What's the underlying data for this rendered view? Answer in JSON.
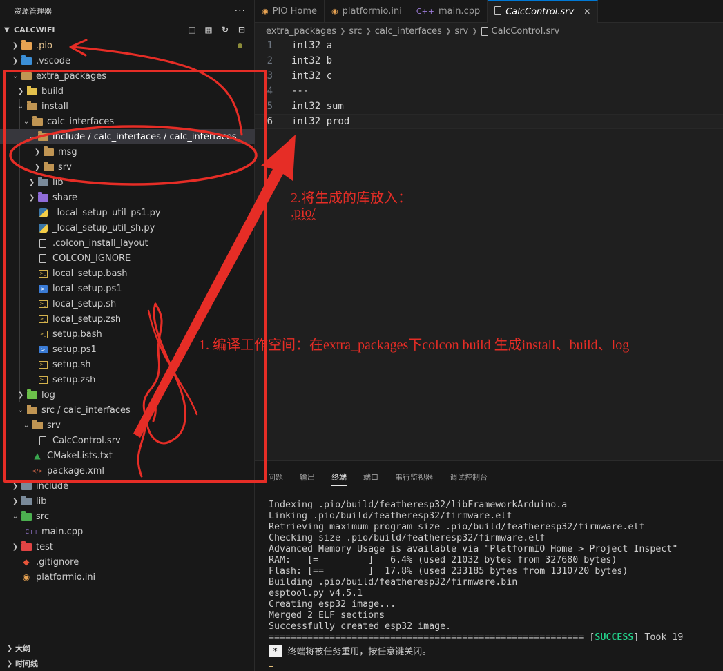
{
  "sidebar": {
    "title": "资源管理器",
    "more": "···",
    "workspace": "CALCWIFI",
    "tree": [
      {
        "label": ".pio",
        "depth": 1,
        "chev": "closed",
        "icon": "pio-folder-icon",
        "color": "#e8a352"
      },
      {
        "label": ".vscode",
        "depth": 1,
        "chev": "closed",
        "icon": "vscode-folder-icon",
        "color": "#3b8fd8"
      },
      {
        "label": "extra_packages",
        "depth": 1,
        "chev": "open",
        "icon": "folder-icon",
        "color": "#c09553"
      },
      {
        "label": "build",
        "depth": 2,
        "chev": "closed",
        "icon": "build-folder-icon",
        "color": "#e3c04c"
      },
      {
        "label": "install",
        "depth": 2,
        "chev": "open",
        "icon": "folder-icon",
        "color": "#c09553"
      },
      {
        "label": "calc_interfaces",
        "depth": 3,
        "chev": "open",
        "icon": "folder-icon",
        "color": "#c09553"
      },
      {
        "label": "include / calc_interfaces / calc_interfaces",
        "depth": 4,
        "chev": "open",
        "icon": "folder-icon",
        "color": "#c09553",
        "selected": true
      },
      {
        "label": "msg",
        "depth": 5,
        "chev": "closed",
        "icon": "folder-icon",
        "color": "#c09553"
      },
      {
        "label": "srv",
        "depth": 5,
        "chev": "closed",
        "icon": "folder-icon",
        "color": "#c09553"
      },
      {
        "label": "lib",
        "depth": 4,
        "chev": "closed",
        "icon": "lib-folder-icon",
        "color": "#7a8a9a"
      },
      {
        "label": "share",
        "depth": 4,
        "chev": "closed",
        "icon": "share-folder-icon",
        "color": "#8f6cd8"
      },
      {
        "label": "_local_setup_util_ps1.py",
        "depth": 4,
        "chev": "none",
        "icon": "python-file-icon"
      },
      {
        "label": "_local_setup_util_sh.py",
        "depth": 4,
        "chev": "none",
        "icon": "python-file-icon"
      },
      {
        "label": ".colcon_install_layout",
        "depth": 4,
        "chev": "none",
        "icon": "file-icon"
      },
      {
        "label": "COLCON_IGNORE",
        "depth": 4,
        "chev": "none",
        "icon": "file-icon"
      },
      {
        "label": "local_setup.bash",
        "depth": 4,
        "chev": "none",
        "icon": "shell-file-icon"
      },
      {
        "label": "local_setup.ps1",
        "depth": 4,
        "chev": "none",
        "icon": "powershell-file-icon"
      },
      {
        "label": "local_setup.sh",
        "depth": 4,
        "chev": "none",
        "icon": "shell-file-icon"
      },
      {
        "label": "local_setup.zsh",
        "depth": 4,
        "chev": "none",
        "icon": "shell-file-icon"
      },
      {
        "label": "setup.bash",
        "depth": 4,
        "chev": "none",
        "icon": "shell-file-icon"
      },
      {
        "label": "setup.ps1",
        "depth": 4,
        "chev": "none",
        "icon": "powershell-file-icon"
      },
      {
        "label": "setup.sh",
        "depth": 4,
        "chev": "none",
        "icon": "shell-file-icon"
      },
      {
        "label": "setup.zsh",
        "depth": 4,
        "chev": "none",
        "icon": "shell-file-icon"
      },
      {
        "label": "log",
        "depth": 2,
        "chev": "closed",
        "icon": "log-folder-icon",
        "color": "#6cc04a"
      },
      {
        "label": "src / calc_interfaces",
        "depth": 2,
        "chev": "open",
        "icon": "folder-icon",
        "color": "#c09553"
      },
      {
        "label": "srv",
        "depth": 3,
        "chev": "open",
        "icon": "folder-icon",
        "color": "#c09553"
      },
      {
        "label": "CalcControl.srv",
        "depth": 4,
        "chev": "none",
        "icon": "file-icon"
      },
      {
        "label": "CMakeLists.txt",
        "depth": 3,
        "chev": "none",
        "icon": "cmake-file-icon"
      },
      {
        "label": "package.xml",
        "depth": 3,
        "chev": "none",
        "icon": "xml-file-icon"
      },
      {
        "label": "include",
        "depth": 1,
        "chev": "closed",
        "icon": "include-folder-icon",
        "color": "#7a8a9a"
      },
      {
        "label": "lib",
        "depth": 1,
        "chev": "closed",
        "icon": "lib-folder-icon",
        "color": "#7a8a9a"
      },
      {
        "label": "src",
        "depth": 1,
        "chev": "open",
        "icon": "src-folder-icon",
        "color": "#4caf50"
      },
      {
        "label": "main.cpp",
        "depth": 2,
        "chev": "none",
        "icon": "cpp-file-icon"
      },
      {
        "label": "test",
        "depth": 1,
        "chev": "closed",
        "icon": "test-folder-icon",
        "color": "#e04444"
      },
      {
        "label": ".gitignore",
        "depth": 1,
        "chev": "none",
        "icon": "git-file-icon"
      },
      {
        "label": "platformio.ini",
        "depth": 1,
        "chev": "none",
        "icon": "platformio-file-icon"
      }
    ],
    "outline": "大纲",
    "timeline": "时间线"
  },
  "tabs": [
    {
      "label": "PIO Home",
      "icon": "platformio-icon",
      "active": false
    },
    {
      "label": "platformio.ini",
      "icon": "platformio-icon",
      "active": false
    },
    {
      "label": "main.cpp",
      "icon": "cpp-icon",
      "active": false
    },
    {
      "label": "CalcControl.srv",
      "icon": "file-icon",
      "active": true
    }
  ],
  "breadcrumb": [
    "extra_packages",
    "src",
    "calc_interfaces",
    "srv",
    "CalcControl.srv"
  ],
  "editor": {
    "lines": [
      {
        "n": "1",
        "text": "int32 a"
      },
      {
        "n": "2",
        "text": "int32 b"
      },
      {
        "n": "3",
        "text": "int32 c"
      },
      {
        "n": "4",
        "text": "---"
      },
      {
        "n": "5",
        "text": "int32 sum"
      },
      {
        "n": "6",
        "text": "int32 prod"
      }
    ],
    "current_line": 6
  },
  "panel": {
    "tabs": [
      "问题",
      "输出",
      "终端",
      "端口",
      "串行监视器",
      "调试控制台"
    ],
    "active_tab": "终端",
    "terminal_lines": [
      "Indexing .pio/build/featheresp32/libFrameworkArduino.a",
      "Linking .pio/build/featheresp32/firmware.elf",
      "Retrieving maximum program size .pio/build/featheresp32/firmware.elf",
      "Checking size .pio/build/featheresp32/firmware.elf",
      "Advanced Memory Usage is available via \"PlatformIO Home > Project Inspect\"",
      "RAM:   [=         ]   6.4% (used 21032 bytes from 327680 bytes)",
      "Flash: [==        ]  17.8% (used 233185 bytes from 1310720 bytes)",
      "Building .pio/build/featheresp32/firmware.bin",
      "esptool.py v4.5.1",
      "Creating esp32 image...",
      "Merged 2 ELF sections",
      "Successfully created esp32 image."
    ],
    "result_rule": "=========================================================",
    "result_open": " [",
    "result_status": "SUCCESS",
    "result_tail": "] Took 19",
    "notice_star": "*",
    "notice": "终端将被任务重用，按任意键关闭。"
  },
  "annotations": {
    "step1": "1. 编译工作空间：在extra_packages下colcon build 生成install、build、log",
    "step2_line1": "2.将生成的库放入：",
    "step2_line2": ".pio/",
    "color": "#e62d26"
  }
}
